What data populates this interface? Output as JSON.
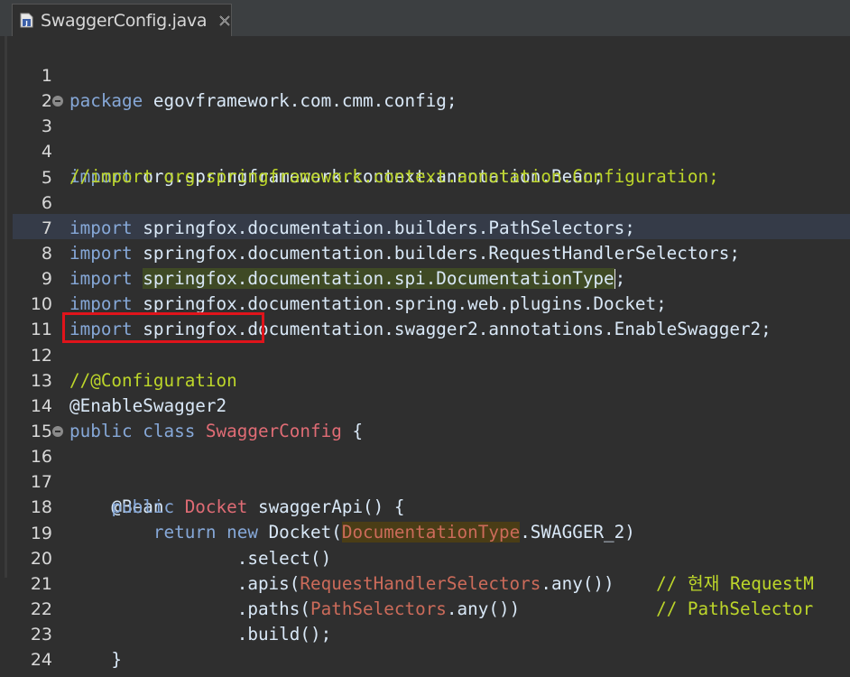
{
  "tab": {
    "title": "SwaggerConfig.java",
    "icon": "java-file-icon",
    "close_icon": "close-icon"
  },
  "editor": {
    "current_line": 8,
    "highlighted_line": 12,
    "lines": [
      {
        "n": "1",
        "text": "package egovframework.com.cmm.config;"
      },
      {
        "n": "2",
        "text": ""
      },
      {
        "n": "3",
        "text": "import org.springframework.context.annotation.Bean;"
      },
      {
        "n": "4",
        "text": "//import org.springframework.context.annotation.Configuration;"
      },
      {
        "n": "5",
        "text": ""
      },
      {
        "n": "6",
        "text": "import springfox.documentation.builders.PathSelectors;"
      },
      {
        "n": "7",
        "text": "import springfox.documentation.builders.RequestHandlerSelectors;"
      },
      {
        "n": "8",
        "text": "import springfox.documentation.spi.DocumentationType;"
      },
      {
        "n": "9",
        "text": "import springfox.documentation.spring.web.plugins.Docket;"
      },
      {
        "n": "10",
        "text": "import springfox.documentation.swagger2.annotations.EnableSwagger2;"
      },
      {
        "n": "11",
        "text": ""
      },
      {
        "n": "12",
        "text": "//@Configuration"
      },
      {
        "n": "13",
        "text": "@EnableSwagger2"
      },
      {
        "n": "14",
        "text": "public class SwaggerConfig {"
      },
      {
        "n": "15",
        "text": ""
      },
      {
        "n": "16",
        "text": "    @Bean"
      },
      {
        "n": "17",
        "text": "    public Docket swaggerApi() {"
      },
      {
        "n": "18",
        "text": "        return new Docket(DocumentationType.SWAGGER_2)"
      },
      {
        "n": "19",
        "text": "                .select()"
      },
      {
        "n": "20",
        "text": "                .apis(RequestHandlerSelectors.any())    // 현재 RequestM"
      },
      {
        "n": "21",
        "text": "                .paths(PathSelectors.any())             // PathSelector"
      },
      {
        "n": "22",
        "text": "                .build();"
      },
      {
        "n": "23",
        "text": "    }"
      },
      {
        "n": "24",
        "text": "}"
      }
    ]
  },
  "colors": {
    "background": "#2f2f2f",
    "keyword": "#86a8d8",
    "comment": "#bdd62a",
    "type": "#e06c75",
    "highlight_box": "#e0141b"
  }
}
